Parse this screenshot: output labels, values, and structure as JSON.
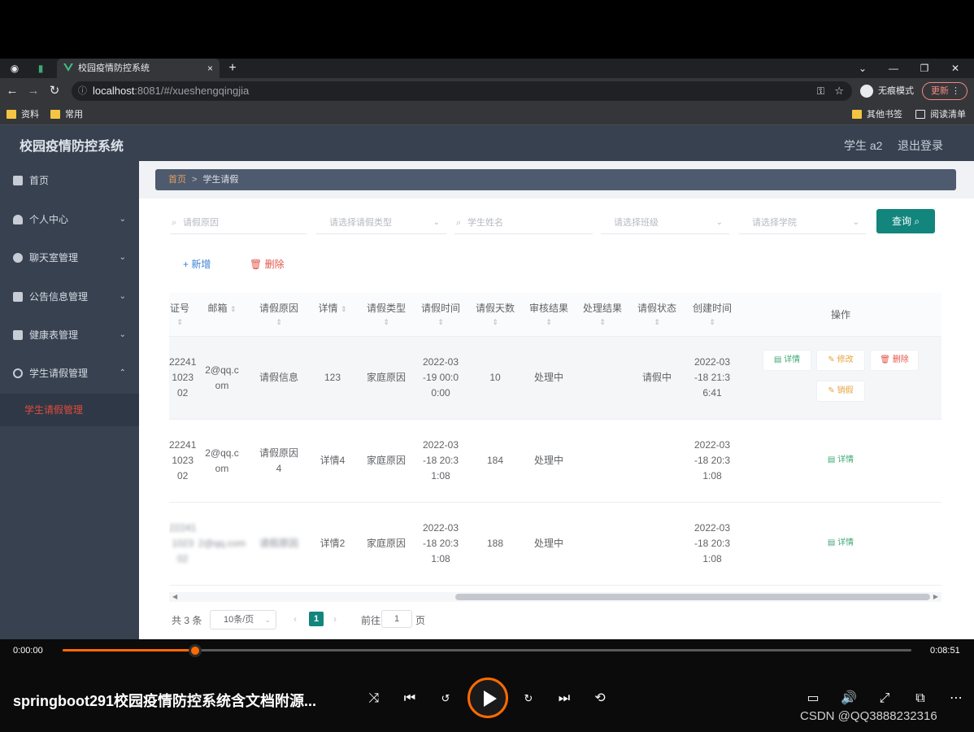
{
  "browser": {
    "tab_title": "校园疫情防控系统",
    "tab_close": "×",
    "new_tab": "+",
    "url_host": "localhost",
    "url_path": ":8081/#/xueshengqingjia",
    "incognito_label": "无痕模式",
    "update_label": "更新",
    "bookmarks": [
      "资料",
      "常用"
    ],
    "bookmarks_right": [
      "其他书签",
      "阅读清单"
    ],
    "window_controls": [
      "⌄",
      "—",
      "❐",
      "✕"
    ]
  },
  "app": {
    "title": "校园疫情防控系统",
    "user": "学生 a2",
    "logout": "退出登录"
  },
  "sidebar": {
    "items": [
      {
        "label": "首页"
      },
      {
        "label": "个人中心"
      },
      {
        "label": "聊天室管理"
      },
      {
        "label": "公告信息管理"
      },
      {
        "label": "健康表管理"
      },
      {
        "label": "学生请假管理"
      }
    ],
    "submenu": "学生请假管理"
  },
  "breadcrumb": {
    "home": "首页",
    "sep": ">",
    "current": "学生请假"
  },
  "search": {
    "reason": "请假原因",
    "type": "请选择请假类型",
    "name": "学生姓名",
    "class": "请选择班级",
    "college": "请选择学院",
    "query": "查询"
  },
  "toolbar": {
    "add": "+ 新增",
    "delete": "删除"
  },
  "table": {
    "headers": [
      "证号",
      "邮箱",
      "请假原因",
      "详情",
      "请假类型",
      "请假时间",
      "请假天数",
      "审核结果",
      "处理结果",
      "请假状态",
      "创建时间",
      "操作"
    ],
    "rows": [
      {
        "id": "22241 1023 02",
        "email": "2@qq.c om",
        "reason": "请假信息",
        "detail": "123",
        "type": "家庭原因",
        "time": "2022-03 -19 00:0 0:00",
        "days": "10",
        "audit": "处理中",
        "result": "",
        "status": "请假中",
        "created": "2022-03 -18 21:3 6:41"
      },
      {
        "id": "22241 1023 02",
        "email": "2@qq.c om",
        "reason": "请假原因 4",
        "detail": "详情4",
        "type": "家庭原因",
        "time": "2022-03 -18 20:3 1:08",
        "days": "184",
        "audit": "处理中",
        "result": "",
        "status": "",
        "created": "2022-03 -18 20:3 1:08"
      },
      {
        "id": "22241 1023 02",
        "email": "2@qq.com",
        "reason": "请假原因",
        "detail": "详情2",
        "type": "家庭原因",
        "time": "2022-03 -18 20:3 1:08",
        "days": "188",
        "audit": "处理中",
        "result": "",
        "status": "",
        "created": "2022-03 -18 20:3 1:08"
      }
    ],
    "actions": {
      "detail": "详情",
      "edit": "修改",
      "delete": "删除",
      "leave": "销假"
    }
  },
  "pagination": {
    "total": "共 3 条",
    "page_size": "10条/页",
    "current": "1",
    "goto": "前往",
    "goto_value": "1",
    "page_unit": "页"
  },
  "player": {
    "time_current": "0:00:00",
    "time_total": "0:08:51",
    "progress": 0.156,
    "title": "springboot291校园疫情防控系统含文档附源...",
    "accent": "#ff6a00"
  },
  "watermark": "CSDN @QQ3888232316"
}
